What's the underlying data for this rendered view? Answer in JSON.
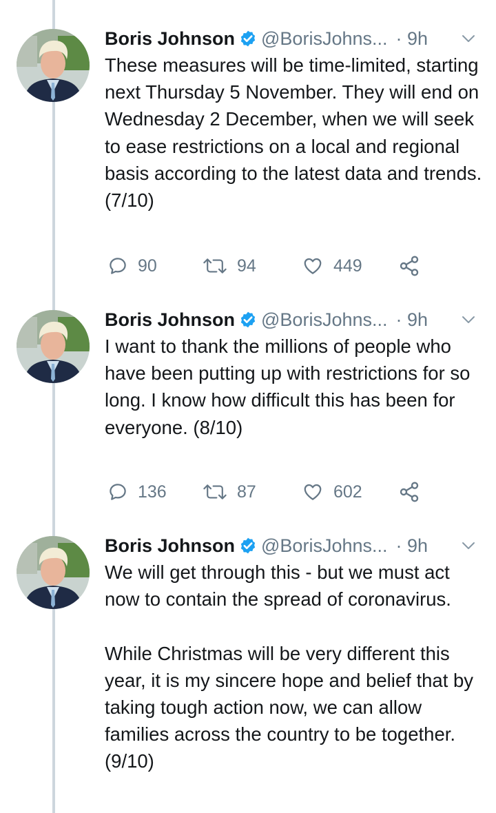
{
  "tweets": [
    {
      "author": {
        "name": "Boris Johnson",
        "handle": "@BorisJohns...",
        "verified": true
      },
      "time": "· 9h",
      "text": "These measures will be time-limited, starting next Thursday 5 November. They will end on Wednesday 2 December, when we will seek to ease restrictions on a local and regional basis according to the latest data and trends. (7/10)",
      "actions": {
        "replies": "90",
        "retweets": "94",
        "likes": "449"
      }
    },
    {
      "author": {
        "name": "Boris Johnson",
        "handle": "@BorisJohns...",
        "verified": true
      },
      "time": "· 9h",
      "text": "I want to thank the millions of people who have been putting up with restrictions for so long. I know how difficult this has been for everyone. (8/10)",
      "actions": {
        "replies": "136",
        "retweets": "87",
        "likes": "602"
      }
    },
    {
      "author": {
        "name": "Boris Johnson",
        "handle": "@BorisJohns...",
        "verified": true
      },
      "time": "· 9h",
      "text": "We will get through this - but we must act now to contain the spread of coronavirus.\n\nWhile Christmas will be very different this year, it is my sincere hope and belief that by taking tough action now, we can allow families across the country to be together. (9/10)"
    }
  ],
  "icons": {
    "avatar": "profile-photo",
    "verified": "verified-badge-icon",
    "more": "chevron-down-icon",
    "reply": "reply-icon",
    "retweet": "retweet-icon",
    "like": "heart-icon",
    "share": "share-icon"
  },
  "colors": {
    "text": "#14171a",
    "secondary": "#657786",
    "verified": "#1da1f2",
    "thread_line": "#cdd6dd",
    "background": "#ffffff"
  }
}
